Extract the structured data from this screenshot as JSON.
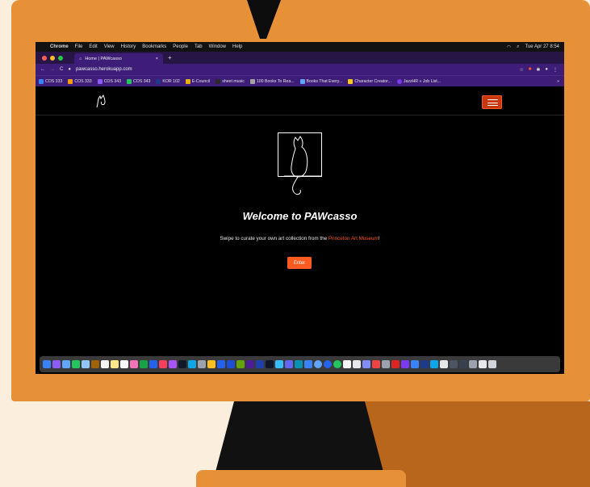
{
  "menubar": {
    "app": "Chrome",
    "items": [
      "File",
      "Edit",
      "View",
      "History",
      "Bookmarks",
      "People",
      "Tab",
      "Window",
      "Help"
    ],
    "clock": "Tue Apr 27  8:54"
  },
  "browser": {
    "tab_title": "Home | PAWcasso",
    "tab_close": "×",
    "new_tab": "+",
    "url": "pawcasso.herokuapp.com",
    "bookmarks": [
      "COS 333",
      "COS 333",
      "COS 343",
      "COS 343",
      "KOR 102",
      "E-Council",
      "sheet music",
      "100 Books To Rea...",
      "Books That Every...",
      "Character Creator...",
      "JazzHR » Job List..."
    ],
    "bookmarks_more": "»"
  },
  "page": {
    "welcome": "Welcome to PAWcasso",
    "tagline_prefix": "Swipe to curate your own art collection from the ",
    "tagline_link": "Princeton Art Museum",
    "tagline_suffix": "!",
    "enter_label": "Enter"
  },
  "colors": {
    "monitor": "#e69138",
    "shadow": "#b8661c",
    "browser_chrome": "#3d1d78",
    "accent": "#ff5a1f"
  }
}
